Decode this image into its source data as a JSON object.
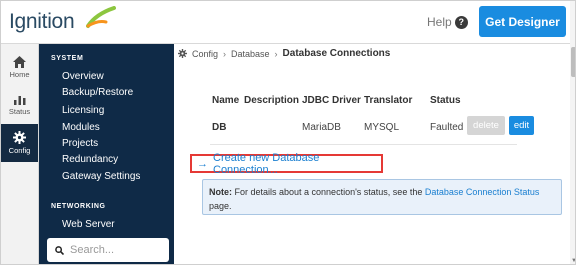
{
  "header": {
    "logo_text": "Ignition",
    "help_label": "Help",
    "get_designer_label": "Get Designer"
  },
  "rail": [
    {
      "label": "Home",
      "icon": "home-icon"
    },
    {
      "label": "Status",
      "icon": "status-chart-icon"
    },
    {
      "label": "Config",
      "icon": "gear-icon",
      "active": true
    }
  ],
  "sidebar": {
    "system_heading": "SYSTEM",
    "system_items": [
      "Overview",
      "Backup/Restore",
      "Licensing",
      "Modules",
      "Projects",
      "Redundancy",
      "Gateway Settings"
    ],
    "networking_heading": "NETWORKING",
    "networking_items": [
      "Web Server"
    ],
    "search_placeholder": "Search..."
  },
  "breadcrumb": {
    "config": "Config",
    "database": "Database",
    "current": "Database Connections"
  },
  "table": {
    "headers": [
      "Name",
      "Description",
      "JDBC Driver",
      "Translator",
      "Status"
    ],
    "rows": [
      {
        "name": "DB",
        "description": "",
        "driver": "MariaDB",
        "translator": "MYSQL",
        "status": "Faulted"
      }
    ],
    "delete_label": "delete",
    "edit_label": "edit"
  },
  "create_link": "Create new Database Connection...",
  "note": {
    "bold": "Note:",
    "text": " For details about a connection's status, see the ",
    "link": "Database Connection Status",
    "tail": " page."
  },
  "colors": {
    "accent": "#1a8ce0",
    "sidebar": "#0f2a47",
    "highlight": "#e53935"
  }
}
